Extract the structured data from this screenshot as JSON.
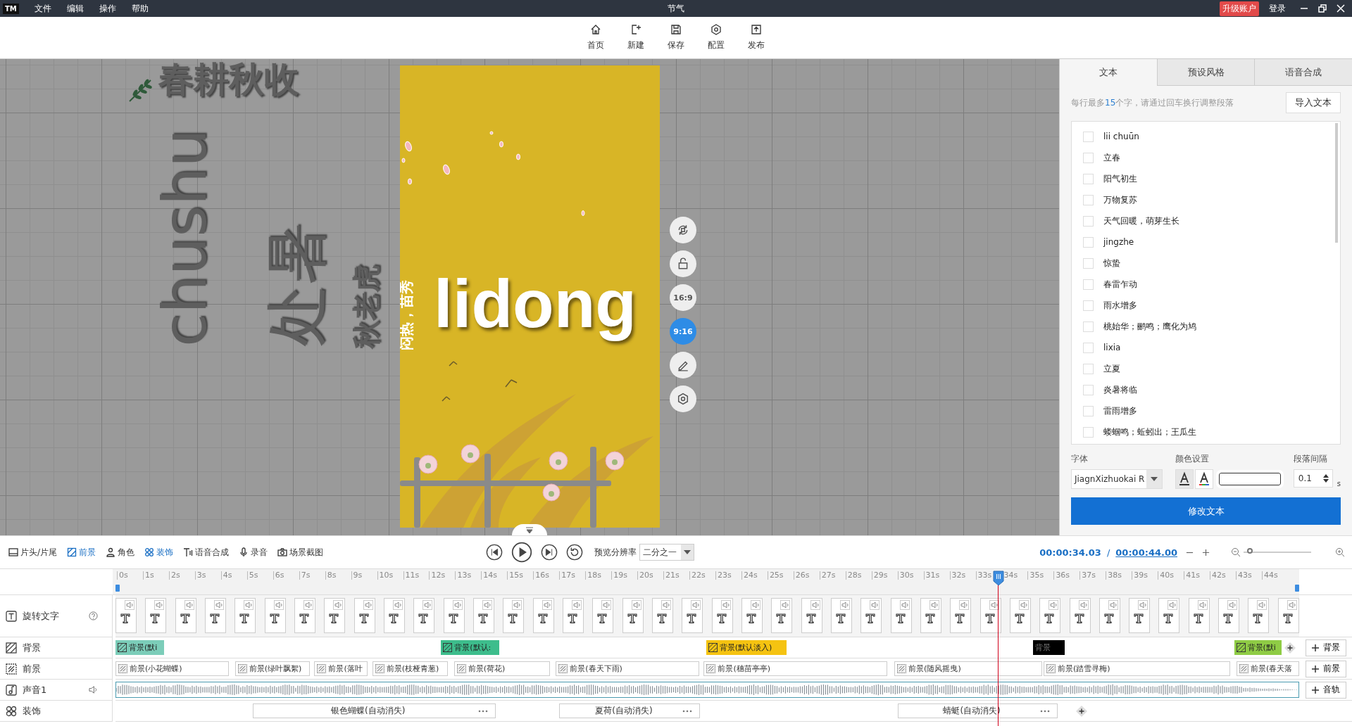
{
  "window": {
    "logo": "TM",
    "menu": [
      "文件",
      "编辑",
      "操作",
      "帮助"
    ],
    "title": "节气",
    "upgrade": "升级账户",
    "login": "登录"
  },
  "toolbar": [
    {
      "kind": "home",
      "label": "首页"
    },
    {
      "kind": "new",
      "label": "新建"
    },
    {
      "kind": "save",
      "label": "保存"
    },
    {
      "kind": "settings",
      "label": "配置"
    },
    {
      "kind": "publish",
      "label": "发布"
    }
  ],
  "canvas": {
    "texts": [
      {
        "kind": "title",
        "text": "春耕秋收"
      },
      {
        "kind": "latin",
        "text": "chushu"
      },
      {
        "kind": "large",
        "text": "处暑"
      },
      {
        "kind": "small",
        "text": "秋老虎"
      }
    ],
    "phone": {
      "subtitle": "闷热，苗秀",
      "headline": "lidong"
    },
    "side_buttons": [
      {
        "kind": "rotate"
      },
      {
        "kind": "lock"
      },
      {
        "kind": "ratio",
        "label": "16:9",
        "selected": false
      },
      {
        "kind": "ratio",
        "label": "9:16",
        "selected": true
      },
      {
        "kind": "edit"
      },
      {
        "kind": "settings"
      }
    ]
  },
  "panel": {
    "tabs": [
      {
        "label": "文本",
        "selected": true
      },
      {
        "label": "预设风格",
        "selected": false
      },
      {
        "label": "语音合成",
        "selected": false
      }
    ],
    "hint": {
      "before": "每行最多",
      "count": "15",
      "after": "个字，请通过回车换行调整段落"
    },
    "import_button": "导入文本",
    "lines": [
      {
        "text": "lii chuūn",
        "checked": false
      },
      {
        "text": "立春",
        "checked": false
      },
      {
        "text": "阳气初生",
        "checked": false
      },
      {
        "text": "万物复苏",
        "checked": false
      },
      {
        "text": "天气回暖，萌芽生长",
        "checked": false
      },
      {
        "text": "jingzhe",
        "checked": false
      },
      {
        "text": "惊蛰",
        "checked": false
      },
      {
        "text": "春雷乍动",
        "checked": false
      },
      {
        "text": "雨水增多",
        "checked": false
      },
      {
        "text": "桃始华；鹂鸣；鹰化为鸠",
        "checked": false
      },
      {
        "text": "lixia",
        "checked": false
      },
      {
        "text": "立夏",
        "checked": false
      },
      {
        "text": "炎暑将临",
        "checked": false
      },
      {
        "text": "雷雨增多",
        "checked": false
      },
      {
        "text": "蝼蝈鸣；蚯蚓出；王瓜生",
        "checked": false
      }
    ],
    "font_label": "字体",
    "font_value": "JiagnXizhuokai R",
    "color_label": "颜色设置",
    "spacing_label": "段落间隔",
    "spacing_value": "0.1",
    "spacing_unit": "s",
    "submit": "修改文本"
  },
  "timeline": {
    "tools": [
      {
        "kind": "film",
        "label": "片头/片尾",
        "active": false
      },
      {
        "kind": "foreground",
        "label": "前景",
        "active": true
      },
      {
        "kind": "person",
        "label": "角色",
        "active": false
      },
      {
        "kind": "decor",
        "label": "装饰",
        "active": true
      },
      {
        "kind": "tts",
        "label": "语音合成",
        "active": false
      },
      {
        "kind": "mic",
        "label": "录音",
        "active": false
      },
      {
        "kind": "camera",
        "label": "场景截图",
        "active": false
      }
    ],
    "resolution_label": "预览分辨率",
    "resolution": "二分之一",
    "current_time": "00:00:34.03",
    "separator": "/",
    "total_time": "00:00:44.00",
    "zoom": {
      "level": 0.05
    },
    "playhead": {
      "level": 0.773
    },
    "ticks": [
      "0s",
      "1s",
      "2s",
      "3s",
      "4s",
      "5s",
      "6s",
      "7s",
      "8s",
      "9s",
      "10s",
      "11s",
      "12s",
      "13s",
      "14s",
      "15s",
      "16s",
      "17s",
      "18s",
      "19s",
      "20s",
      "21s",
      "22s",
      "23s",
      "24s",
      "25s",
      "26s",
      "27s",
      "28s",
      "29s",
      "30s",
      "31s",
      "32s",
      "33s",
      "34s",
      "35s",
      "36s",
      "37s",
      "38s",
      "39s",
      "40s",
      "41s",
      "42s",
      "43s",
      "44s"
    ],
    "tracks": [
      {
        "kind": "text",
        "name": "旋转文字",
        "clips": [
          {
            "kind": "text"
          },
          {
            "kind": "text"
          },
          {
            "kind": "text"
          },
          {
            "kind": "text"
          },
          {
            "kind": "text"
          },
          {
            "kind": "text"
          },
          {
            "kind": "text"
          },
          {
            "kind": "text"
          },
          {
            "kind": "text"
          },
          {
            "kind": "text"
          },
          {
            "kind": "text"
          },
          {
            "kind": "text"
          },
          {
            "kind": "text"
          },
          {
            "kind": "text"
          },
          {
            "kind": "text"
          },
          {
            "kind": "text"
          },
          {
            "kind": "text"
          },
          {
            "kind": "text"
          },
          {
            "kind": "text"
          },
          {
            "kind": "text"
          },
          {
            "kind": "text"
          },
          {
            "kind": "text"
          },
          {
            "kind": "text"
          },
          {
            "kind": "text"
          },
          {
            "kind": "text"
          },
          {
            "kind": "text"
          },
          {
            "kind": "text"
          },
          {
            "kind": "text"
          },
          {
            "kind": "text"
          },
          {
            "kind": "text"
          },
          {
            "kind": "text"
          },
          {
            "kind": "text"
          },
          {
            "kind": "text"
          },
          {
            "kind": "text"
          },
          {
            "kind": "text"
          },
          {
            "kind": "text"
          },
          {
            "kind": "text"
          },
          {
            "kind": "text"
          },
          {
            "kind": "text"
          },
          {
            "kind": "text"
          }
        ]
      },
      {
        "kind": "background",
        "name": "背景",
        "add": "背景",
        "clips": [
          {
            "label": "背景(默i",
            "color": "#7ccdb9"
          },
          {
            "label": "背景(默认:",
            "color": "#3dbd8c"
          },
          {
            "label": "背景(默认淡入)",
            "color": "#f5c311"
          },
          {
            "label": "背景",
            "color": "#000000"
          },
          {
            "label": "背景(默i",
            "color": "#8fcc45"
          }
        ]
      },
      {
        "kind": "foreground",
        "name": "前景",
        "add": "前景",
        "clips": [
          {
            "label": "前景(小花蝴蝶)"
          },
          {
            "label": "前景(绿叶飘絮)"
          },
          {
            "label": "前景(落叶"
          },
          {
            "label": "前景(枝桠青葱)"
          },
          {
            "label": "前景(荷花)"
          },
          {
            "label": "前景(春天下雨)"
          },
          {
            "label": "前景(穗苗亭亭)"
          },
          {
            "label": "前景(随风摇曳)"
          },
          {
            "label": "前景(踏雪寻梅)"
          },
          {
            "label": "前景(春天落"
          }
        ]
      },
      {
        "kind": "audio",
        "name": "声音1",
        "add": "音轨"
      },
      {
        "kind": "decor",
        "name": "装饰",
        "clips": [
          {
            "label": "银色蝴蝶(自动消失)"
          },
          {
            "label": "夏荷(自动消失)"
          },
          {
            "label": "蜻蜓(自动消失)"
          }
        ]
      }
    ]
  }
}
